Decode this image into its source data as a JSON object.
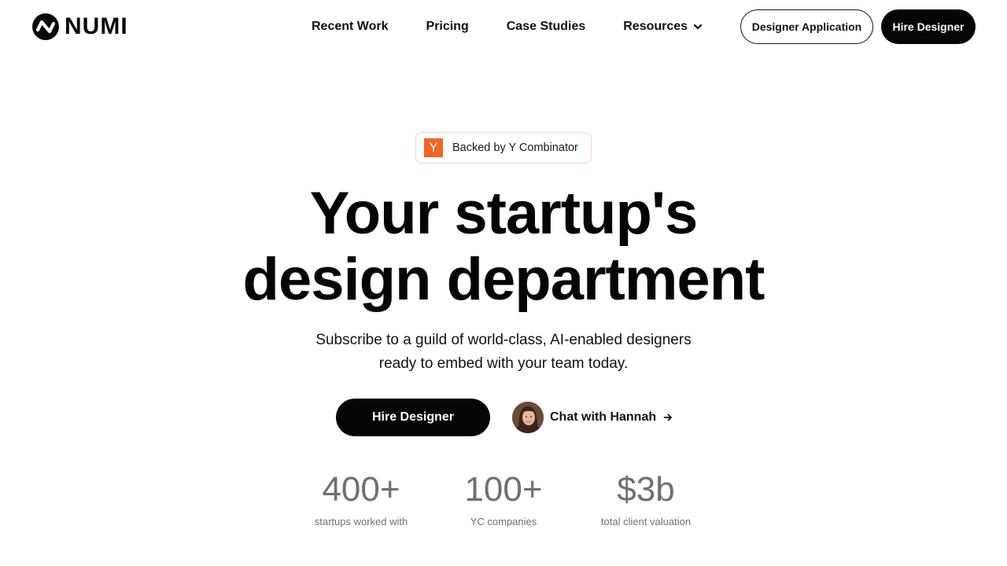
{
  "brand": {
    "name": "NUMI",
    "logo_icon": "numi-wave-logo-icon"
  },
  "nav": {
    "items": [
      {
        "label": "Recent Work"
      },
      {
        "label": "Pricing"
      },
      {
        "label": "Case Studies"
      },
      {
        "label": "Resources",
        "icon": "chevron-down-icon"
      }
    ],
    "designer_application_label": "Designer Application",
    "hire_designer_label": "Hire Designer"
  },
  "badge": {
    "logo_letter": "Y",
    "text": "Backed by Y Combinator",
    "logo_color": "#f26522"
  },
  "hero": {
    "title_line1": "Your startup's",
    "title_line2": "design department",
    "subtitle_line1": "Subscribe to a guild of world-class, AI-enabled designers",
    "subtitle_line2": "ready to embed with your team today.",
    "cta_label": "Hire Designer",
    "chat_label": "Chat with Hannah",
    "chat_icon": "arrow-right-icon"
  },
  "stats": [
    {
      "value": "400+",
      "label": "startups worked with"
    },
    {
      "value": "100+",
      "label": "YC companies"
    },
    {
      "value": "$3b",
      "label": "total client valuation"
    }
  ],
  "colors": {
    "primary": "#050505",
    "muted": "#6f6f6f",
    "background": "#ffffff"
  }
}
